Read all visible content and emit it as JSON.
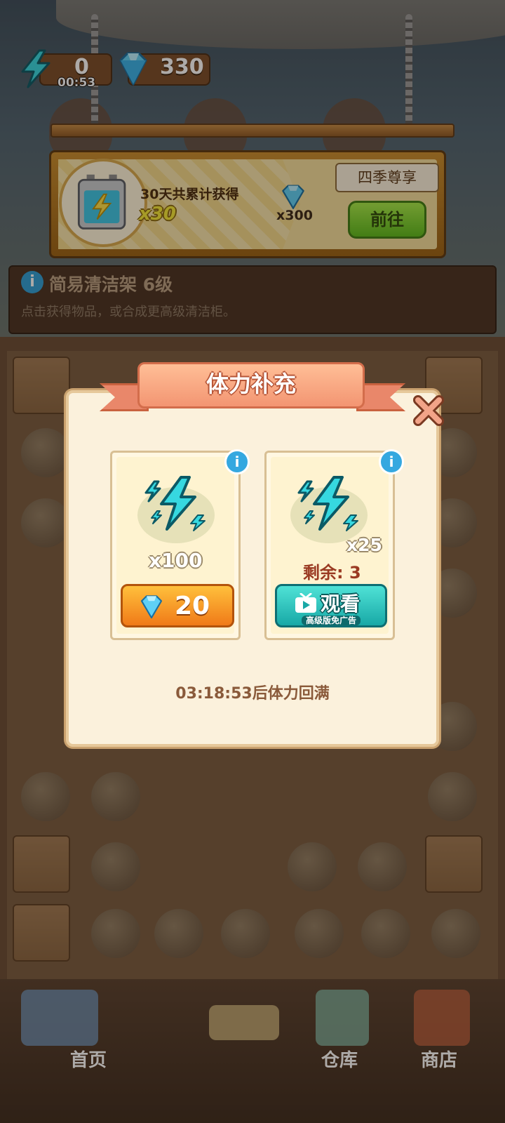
{
  "hud": {
    "energy_value": "0",
    "energy_timer": "00:53",
    "gems_value": "330"
  },
  "promo": {
    "title": "30天共累计获得",
    "battery_qty": "x30",
    "gem_qty": "x300",
    "badge": "四季尊享",
    "go_label": "前往"
  },
  "info": {
    "title": "简易清洁架 6级",
    "description": "点击获得物品，或合成更高级清洁柜。"
  },
  "modal": {
    "title": "体力补充",
    "cards": [
      {
        "qty": "x100",
        "price": "20"
      },
      {
        "qty": "x25",
        "remaining": "剩余: 3",
        "watch_label": "观看",
        "watch_sub": "高级版免广告"
      }
    ],
    "refill_text": "03:18:53后体力回满"
  },
  "nav": {
    "home": "首页",
    "warehouse": "仓库",
    "shop": "商店"
  },
  "colors": {
    "energy": "#36d8e0",
    "gem": "#5fd0f5",
    "go_button": "#5dbb1e",
    "buy_button": "#f07a18",
    "watch_button": "#18a8a6"
  }
}
